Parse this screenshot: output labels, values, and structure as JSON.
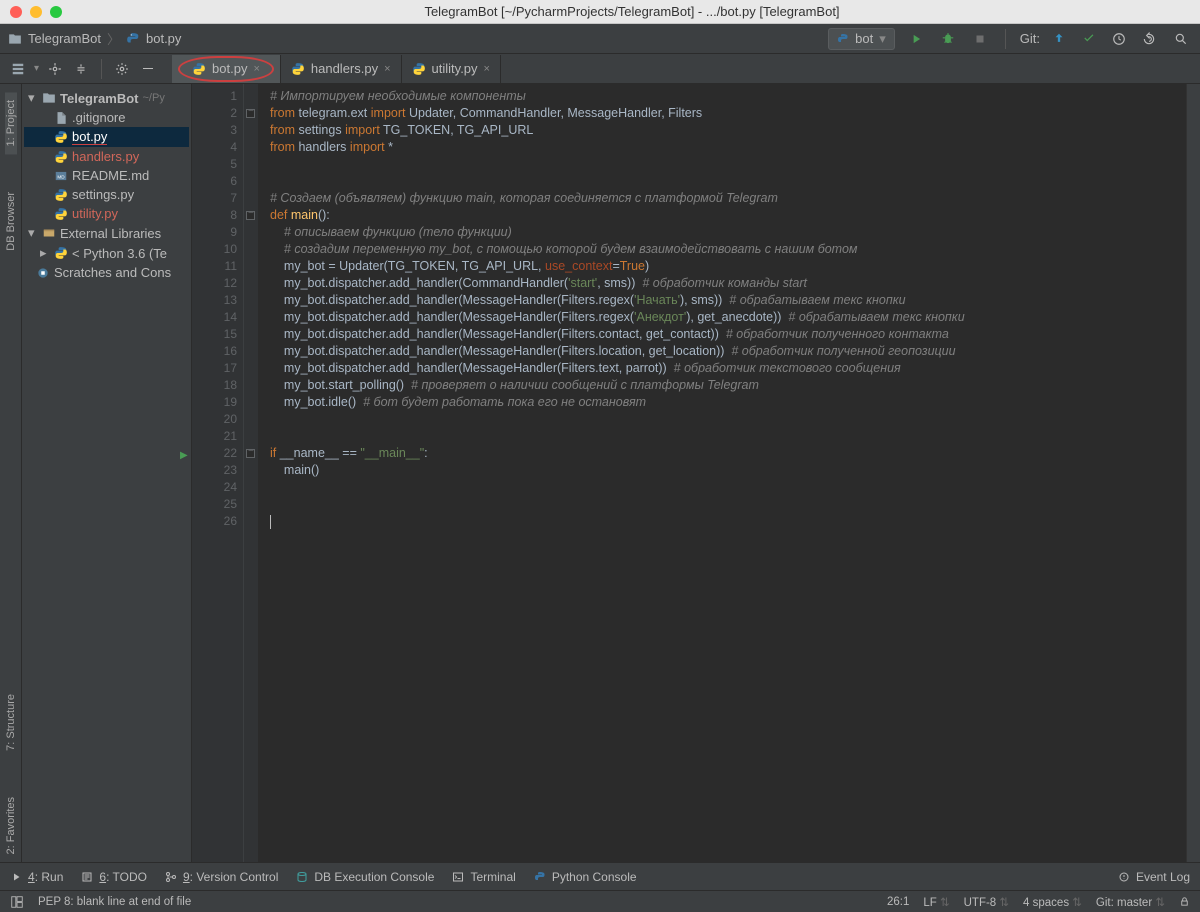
{
  "title": "TelegramBot [~/PycharmProjects/TelegramBot] - .../bot.py [TelegramBot]",
  "breadcrumb": {
    "project": "TelegramBot",
    "file": "bot.py"
  },
  "run_config": {
    "label": "bot"
  },
  "git_label": "Git:",
  "editor_tabs": [
    {
      "name": "bot.py",
      "active": true,
      "modified": false
    },
    {
      "name": "handlers.py",
      "active": false,
      "modified": true
    },
    {
      "name": "utility.py",
      "active": false,
      "modified": true
    }
  ],
  "left_tools": [
    {
      "label": "1: Project",
      "active": true
    },
    {
      "label": "DB Browser",
      "active": false
    },
    {
      "label": "7: Structure",
      "active": false
    },
    {
      "label": "2: Favorites",
      "active": false
    }
  ],
  "tree": {
    "root": "TelegramBot",
    "root_path": "~/Py",
    "items": [
      {
        "name": ".gitignore",
        "type": "file",
        "selected": false,
        "modified": false
      },
      {
        "name": "bot.py",
        "type": "py",
        "selected": true,
        "modified": false
      },
      {
        "name": "handlers.py",
        "type": "py",
        "selected": false,
        "modified": true
      },
      {
        "name": "README.md",
        "type": "md",
        "selected": false,
        "modified": false
      },
      {
        "name": "settings.py",
        "type": "py",
        "selected": false,
        "modified": false
      },
      {
        "name": "utility.py",
        "type": "py",
        "selected": false,
        "modified": true
      }
    ],
    "external": "External Libraries",
    "python": "Python 3.6 (Te",
    "scratches": "Scratches and Cons"
  },
  "code": {
    "lines": [
      {
        "n": 1,
        "html": "<span class='cmt'># Импортируем необходимые компоненты</span>"
      },
      {
        "n": 2,
        "html": "<span class='kw'>from</span> <span class='txt'>telegram.ext</span> <span class='kw'>import</span> <span class='txt'>Updater, CommandHandler, MessageHandler, Filters</span>",
        "fold": true
      },
      {
        "n": 3,
        "html": "<span class='kw'>from</span> <span class='txt'>settings</span> <span class='kw'>import</span> <span class='txt'>TG_TOKEN, TG_API_URL</span>"
      },
      {
        "n": 4,
        "html": "<span class='kw'>from</span> <span class='txt'>handlers</span> <span class='kw'>import</span> <span class='txt'>*</span>"
      },
      {
        "n": 5,
        "html": ""
      },
      {
        "n": 6,
        "html": ""
      },
      {
        "n": 7,
        "html": "<span class='cmt'># Создаем (объявляем) функцию main, которая соединяется с платформой Telegram</span>"
      },
      {
        "n": 8,
        "html": "<span class='kw'>def</span> <span class='fn'>main</span><span class='txt'>():</span>",
        "fold": true
      },
      {
        "n": 9,
        "html": "    <span class='cmt'># описываем функцию (тело функции)</span>"
      },
      {
        "n": 10,
        "html": "    <span class='cmt'># создадим переменную my_bot, с помощью которой будем взаимодействовать с нашим ботом</span>"
      },
      {
        "n": 11,
        "html": "    <span class='txt'>my_bot = Updater(TG_TOKEN, TG_API_URL, </span><span class='par'>use_context</span><span class='txt'>=</span><span class='kw'>True</span><span class='txt'>)</span>"
      },
      {
        "n": 12,
        "html": "    <span class='txt'>my_bot.dispatcher.add_handler(CommandHandler(</span><span class='str'>'start'</span><span class='txt'>, sms))  </span><span class='cmt'># обработчик команды start</span>"
      },
      {
        "n": 13,
        "html": "    <span class='txt'>my_bot.dispatcher.add_handler(MessageHandler(Filters.regex(</span><span class='str'>'Начать'</span><span class='txt'>), sms))  </span><span class='cmt'># обрабатываем текс кнопки</span>"
      },
      {
        "n": 14,
        "html": "    <span class='txt'>my_bot.dispatcher.add_handler(MessageHandler(Filters.regex(</span><span class='str'>'Анекдот'</span><span class='txt'>), get_anecdote))  </span><span class='cmt'># обрабатываем текс кнопки</span>"
      },
      {
        "n": 15,
        "html": "    <span class='txt'>my_bot.dispatcher.add_handler(MessageHandler(Filters.contact, get_contact))  </span><span class='cmt'># обработчик полученного контакта</span>"
      },
      {
        "n": 16,
        "html": "    <span class='txt'>my_bot.dispatcher.add_handler(MessageHandler(Filters.location, get_location))  </span><span class='cmt'># обработчик полученной геопозиции</span>"
      },
      {
        "n": 17,
        "html": "    <span class='txt'>my_bot.dispatcher.add_handler(MessageHandler(Filters.text, parrot))  </span><span class='cmt'># обработчик текстового сообщения</span>"
      },
      {
        "n": 18,
        "html": "    <span class='txt'>my_bot.start_polling()  </span><span class='cmt'># проверяет о наличии сообщений с платформы Telegram</span>"
      },
      {
        "n": 19,
        "html": "    <span class='txt'>my_bot.idle()  </span><span class='cmt'># бот будет работать пока его не остановят</span>"
      },
      {
        "n": 20,
        "html": ""
      },
      {
        "n": 21,
        "html": ""
      },
      {
        "n": 22,
        "html": "<span class='kw'>if</span> <span class='txt'>__name__ == </span><span class='str'>\"__main__\"</span><span class='txt'>:</span>",
        "run": true,
        "fold": true
      },
      {
        "n": 23,
        "html": "    <span class='txt'>main()</span>"
      },
      {
        "n": 24,
        "html": ""
      },
      {
        "n": 25,
        "html": ""
      },
      {
        "n": 26,
        "html": "<span class='caret'></span>"
      }
    ]
  },
  "bottom_tabs": [
    {
      "label": "4: Run",
      "icon": "run"
    },
    {
      "label": "6: TODO",
      "icon": "todo"
    },
    {
      "label": "9: Version Control",
      "icon": "vcs"
    },
    {
      "label": "DB Execution Console",
      "icon": "db"
    },
    {
      "label": "Terminal",
      "icon": "term"
    },
    {
      "label": "Python Console",
      "icon": "py"
    }
  ],
  "event_log": "Event Log",
  "status": {
    "message": "PEP 8: blank line at end of file",
    "cursor": "26:1",
    "eol": "LF",
    "encoding": "UTF-8",
    "indent": "4 spaces",
    "git": "Git: master"
  }
}
